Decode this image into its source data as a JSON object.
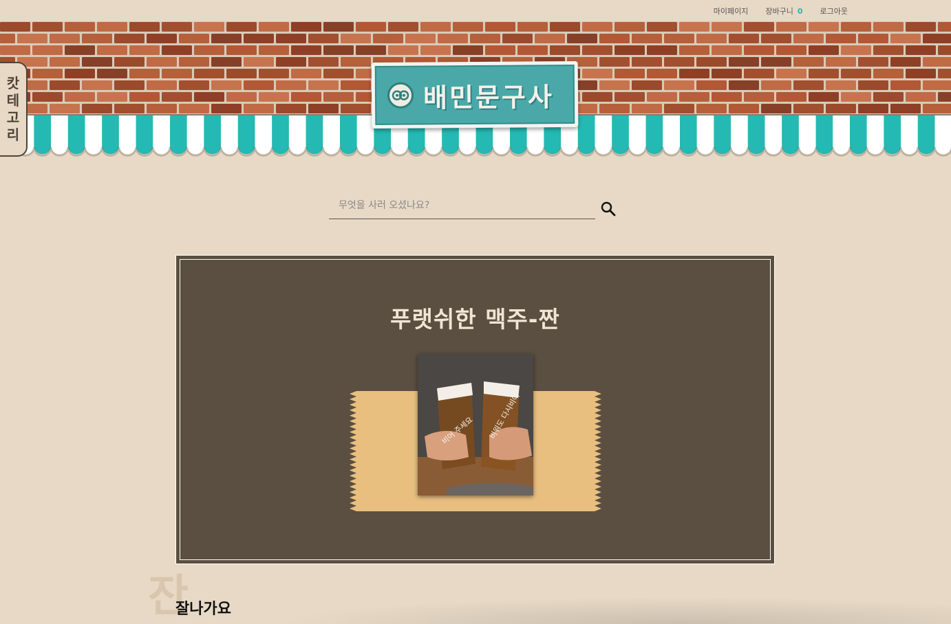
{
  "topnav": {
    "mypage": "마이페이지",
    "cart": "장바구니",
    "cart_count": "0",
    "logout": "로그아웃"
  },
  "logo": {
    "text": "배민문구사"
  },
  "category_tab": {
    "chars": [
      "캇",
      "테",
      "고",
      "리"
    ]
  },
  "search": {
    "placeholder": "무엇을 사러 오셨나요?"
  },
  "banner": {
    "title": "푸랫쉬한 맥주-짠",
    "photo_texts": [
      "비어 주세요",
      "비워도 다시비어"
    ]
  },
  "section": {
    "bg_char": "잔",
    "title": "잘나가요"
  },
  "colors": {
    "background": "#e8d9c6",
    "banner": "#5a4f40",
    "accent_teal": "#2ab7b3",
    "ribbon": "#e9bf80"
  }
}
